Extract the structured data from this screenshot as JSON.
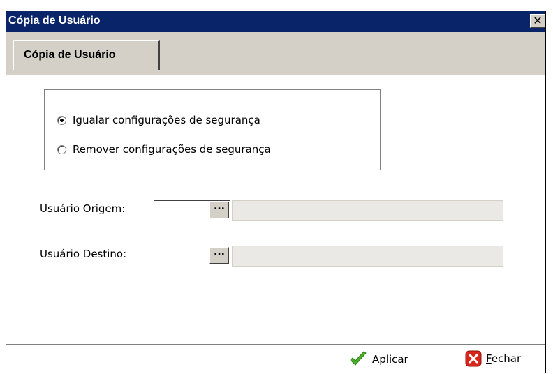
{
  "window": {
    "title": "Cópia de Usuário",
    "close_glyph": "✕"
  },
  "tabs": [
    {
      "label": "Cópia de Usuário",
      "active": true
    }
  ],
  "options": [
    {
      "label": "Igualar configurações de segurança",
      "checked": true
    },
    {
      "label": "Remover configurações de segurança",
      "checked": false
    }
  ],
  "fields": {
    "origem_label": "Usuário Origem:",
    "origem_value": "",
    "origem_name": "",
    "destino_label": "Usuário Destino:",
    "destino_value": "",
    "destino_name": "",
    "lookup_glyph": "..."
  },
  "footer": {
    "apply_mnemonic": "A",
    "apply_rest": "plicar",
    "close_mnemonic": "F",
    "close_rest": "echar"
  },
  "icons": {
    "apply": "check-icon",
    "close": "close-red-icon"
  },
  "colors": {
    "titlebar": "#0a246a",
    "apply_check": "#4caf2a",
    "close_red": "#d9261c"
  }
}
